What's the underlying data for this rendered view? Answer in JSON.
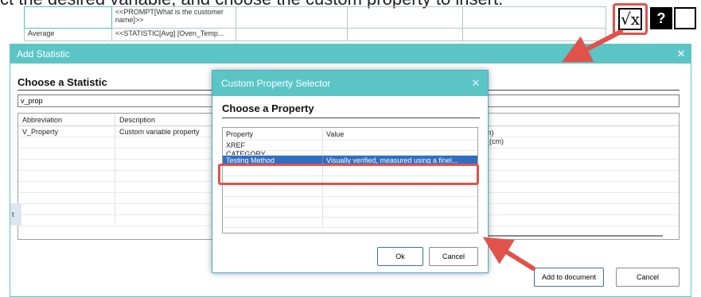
{
  "instruction_text": "ct the desired variable, and choose the custom property to insert.",
  "background_table": {
    "row1_col2": "<<PROMPT[What is the customer name]>>",
    "row2_col1": "Average",
    "row2_col2": "<<STATISTIC[Avg] [Oven_Temp..."
  },
  "toolbar": {
    "sqrt_icon_label": "√x",
    "help_icon_label": "?"
  },
  "add_statistic": {
    "title": "Add Statistic",
    "close_label": "✕",
    "section_title": "Choose a Statistic",
    "search_value": "v_prop",
    "columns": [
      "Abbreviation",
      "Description"
    ],
    "rows": [
      {
        "abbreviation": "V_Property",
        "description": "Custom variable property"
      }
    ],
    "right_units": [
      "m)",
      "_(cm)"
    ],
    "left_stub": "t",
    "add_button": "Add to document",
    "cancel_button": "Cancel"
  },
  "custom_property": {
    "title": "Custom Property Selector",
    "close_label": "✕",
    "section_title": "Choose a Property",
    "columns": [
      "Property",
      "Value"
    ],
    "rows": [
      {
        "property": "XREF",
        "value": "",
        "selected": false
      },
      {
        "property": "CATEGORY",
        "value": "",
        "selected": false,
        "clipped": true
      },
      {
        "property": "Testing Method",
        "value": "Visually verified, measured using a finel...",
        "selected": true
      }
    ],
    "ok_button": "Ok",
    "cancel_button": "Cancel"
  },
  "colors": {
    "titlebar": "#5bc5c5",
    "selection": "#2d6fc4",
    "highlight_red": "#e0524a"
  }
}
